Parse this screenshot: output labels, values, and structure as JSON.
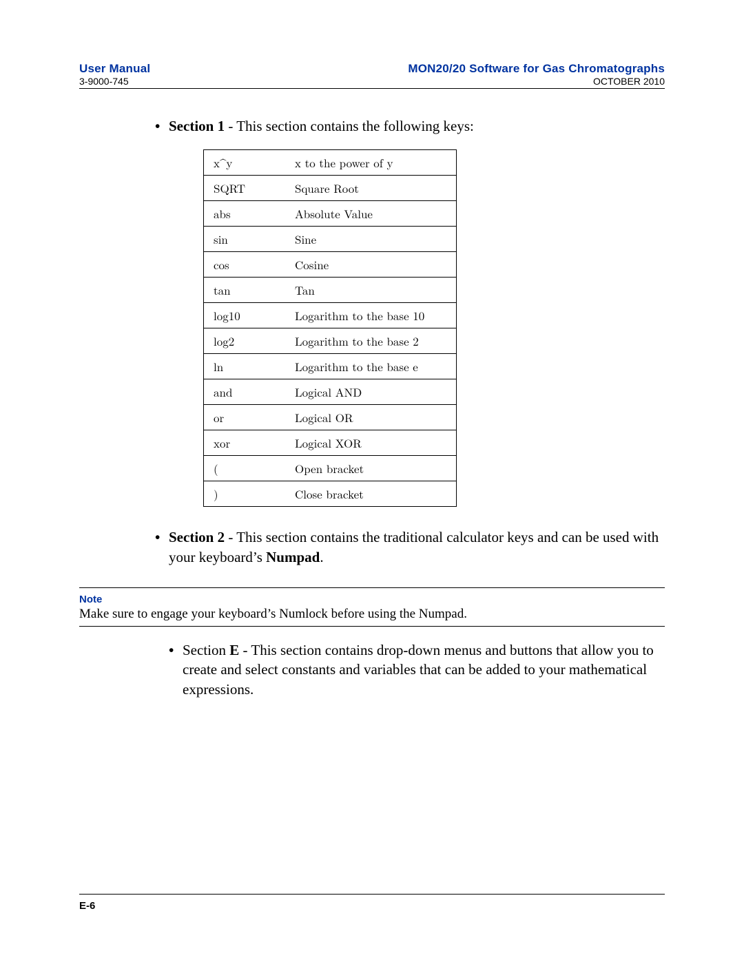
{
  "header": {
    "left_title": "User Manual",
    "left_sub": "3-9000-745",
    "right_title": "MON20/20 Software for Gas Chromatographs",
    "right_sub": "OCTOBER 2010"
  },
  "section1": {
    "label": "Section 1",
    "tail": " - This section contains the following keys:"
  },
  "table_rows": [
    {
      "k": "x^y",
      "d": "x to the power of y"
    },
    {
      "k": "SQRT",
      "d": "Square Root"
    },
    {
      "k": "abs",
      "d": "Absolute Value"
    },
    {
      "k": "sin",
      "d": "Sine"
    },
    {
      "k": "cos",
      "d": "Cosine"
    },
    {
      "k": "tan",
      "d": "Tan"
    },
    {
      "k": "log10",
      "d": "Logarithm to the base 10"
    },
    {
      "k": "log2",
      "d": "Logarithm to the base 2"
    },
    {
      "k": "ln",
      "d": "Logarithm to the base e"
    },
    {
      "k": "and",
      "d": "Logical AND"
    },
    {
      "k": "or",
      "d": "Logical OR"
    },
    {
      "k": "xor",
      "d": "Logical XOR"
    },
    {
      "k": "(",
      "d": "Open bracket"
    },
    {
      "k": ")",
      "d": "Close bracket"
    }
  ],
  "section2": {
    "label": "Section 2",
    "tail": " - This section contains the traditional calculator keys and can be used with your keyboard’s ",
    "bold_tail": "Numpad",
    "period": "."
  },
  "note": {
    "label": "Note",
    "body": "Make sure to engage your keyboard’s Numlock before using the Numpad."
  },
  "sectionE": {
    "pre": "Section ",
    "bold": "E",
    "tail": " - This section contains drop-down menus and buttons that allow you to create and select constants and variables that can be added to your mathematical expressions."
  },
  "footer": {
    "page": "E-6"
  }
}
